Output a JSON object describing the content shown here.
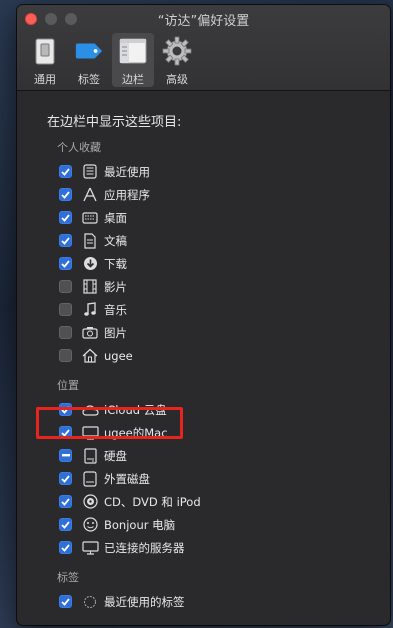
{
  "window": {
    "title": "“访达”偏好设置"
  },
  "toolbar": {
    "items": [
      {
        "label": "通用",
        "icon": "general-icon"
      },
      {
        "label": "标签",
        "icon": "tag-icon"
      },
      {
        "label": "边栏",
        "icon": "sidebar-icon",
        "selected": true
      },
      {
        "label": "高级",
        "icon": "gear-icon"
      }
    ]
  },
  "content": {
    "heading": "在边栏中显示这些项目:",
    "favorites": {
      "title": "个人收藏",
      "items": [
        {
          "label": "最近使用",
          "checked": true,
          "icon": "recents-icon"
        },
        {
          "label": "应用程序",
          "checked": true,
          "icon": "applications-icon"
        },
        {
          "label": "桌面",
          "checked": true,
          "icon": "desktop-icon"
        },
        {
          "label": "文稿",
          "checked": true,
          "icon": "documents-icon"
        },
        {
          "label": "下载",
          "checked": true,
          "icon": "downloads-icon"
        },
        {
          "label": "影片",
          "checked": false,
          "icon": "movies-icon"
        },
        {
          "label": "音乐",
          "checked": false,
          "icon": "music-icon"
        },
        {
          "label": "图片",
          "checked": false,
          "icon": "pictures-icon"
        },
        {
          "label": "ugee",
          "checked": false,
          "icon": "home-icon"
        }
      ]
    },
    "locations": {
      "title": "位置",
      "items": [
        {
          "label": "iCloud 云盘",
          "checked": true,
          "icon": "icloud-icon"
        },
        {
          "label": "ugee的Mac",
          "checked": true,
          "icon": "computer-icon"
        },
        {
          "label": "硬盘",
          "checked": "mixed",
          "icon": "harddisk-icon"
        },
        {
          "label": "外置磁盘",
          "checked": true,
          "icon": "external-disk-icon"
        },
        {
          "label": "CD、DVD 和 iPod",
          "checked": true,
          "icon": "optical-disc-icon"
        },
        {
          "label": "Bonjour 电脑",
          "checked": true,
          "icon": "bonjour-icon"
        },
        {
          "label": "已连接的服务器",
          "checked": true,
          "icon": "server-icon"
        }
      ]
    },
    "tags": {
      "title": "标签",
      "items": [
        {
          "label": "最近使用的标签",
          "checked": true,
          "icon": "recent-tags-icon"
        }
      ]
    }
  },
  "colors": {
    "accent": "#2e6fd8",
    "highlight": "#e8241e"
  }
}
